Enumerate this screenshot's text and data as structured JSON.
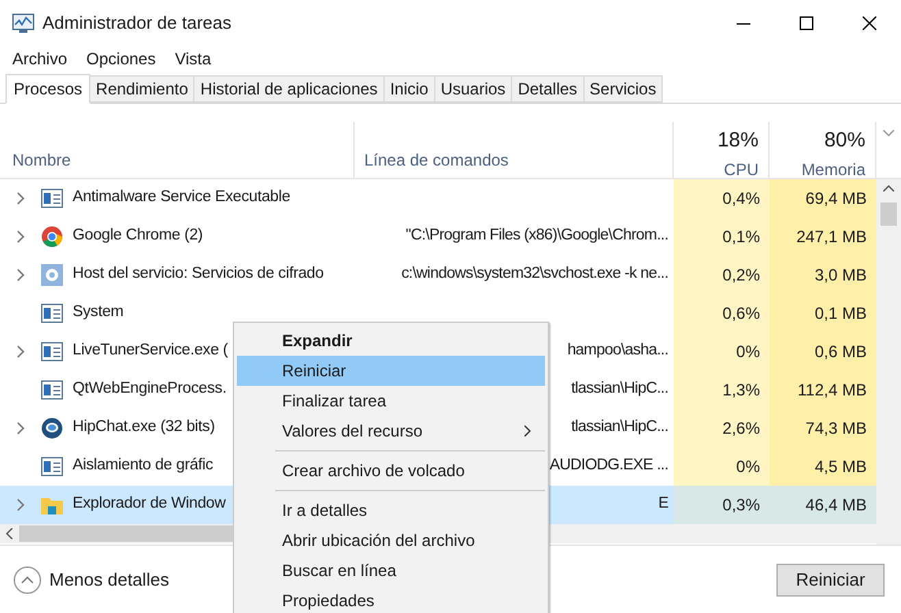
{
  "window": {
    "title": "Administrador de tareas"
  },
  "menu": [
    "Archivo",
    "Opciones",
    "Vista"
  ],
  "tabs": [
    {
      "label": "Procesos",
      "selected": true
    },
    {
      "label": "Rendimiento",
      "selected": false
    },
    {
      "label": "Historial de aplicaciones",
      "selected": false
    },
    {
      "label": "Inicio",
      "selected": false
    },
    {
      "label": "Usuarios",
      "selected": false
    },
    {
      "label": "Detalles",
      "selected": false
    },
    {
      "label": "Servicios",
      "selected": false
    }
  ],
  "columns": {
    "name": "Nombre",
    "command": "Línea de comandos",
    "cpu": {
      "label": "CPU",
      "total": "18%"
    },
    "memory": {
      "label": "Memoria",
      "total": "80%"
    }
  },
  "rows": [
    {
      "kind": "window",
      "name": "Antimalware Service Executable",
      "command": "",
      "cpu": "0,4%",
      "memory": "69,4 MB",
      "expandable": true,
      "selected": false
    },
    {
      "kind": "chrome",
      "name": "Google Chrome (2)",
      "command": "\"C:\\Program Files (x86)\\Google\\Chrom...",
      "cpu": "0,1%",
      "memory": "247,1 MB",
      "expandable": true,
      "selected": false
    },
    {
      "kind": "gear",
      "name": "Host del servicio: Servicios de cifrado",
      "command": "c:\\windows\\system32\\svchost.exe -k ne...",
      "cpu": "0,2%",
      "memory": "3,0 MB",
      "expandable": true,
      "selected": false
    },
    {
      "kind": "window",
      "name": "System",
      "command": "",
      "cpu": "0,6%",
      "memory": "0,1 MB",
      "expandable": false,
      "selected": false
    },
    {
      "kind": "window",
      "name": "LiveTunerService.exe (",
      "command": "hampoo\\asha...",
      "cpu": "0%",
      "memory": "0,6 MB",
      "expandable": true,
      "selected": false
    },
    {
      "kind": "window",
      "name": "QtWebEngineProcess.",
      "command": "tlassian\\HipC...",
      "cpu": "1,3%",
      "memory": "112,4 MB",
      "expandable": false,
      "selected": false
    },
    {
      "kind": "chat",
      "name": "HipChat.exe (32 bits)",
      "command": "tlassian\\HipC...",
      "cpu": "2,6%",
      "memory": "74,3 MB",
      "expandable": true,
      "selected": false
    },
    {
      "kind": "window",
      "name": "Aislamiento de gráfic",
      "command": "AUDIODG.EXE ...",
      "cpu": "0%",
      "memory": "4,5 MB",
      "expandable": false,
      "selected": false
    },
    {
      "kind": "folder",
      "name": "Explorador de Window",
      "command": "E",
      "cpu": "0,3%",
      "memory": "46,4 MB",
      "expandable": true,
      "selected": true
    }
  ],
  "footer": {
    "details": "Menos detalles",
    "button": "Reiniciar"
  },
  "context_menu": [
    {
      "label": "Expandir",
      "kind": "default",
      "selected": false
    },
    {
      "label": "Reiniciar",
      "kind": "item",
      "selected": true
    },
    {
      "label": "Finalizar tarea",
      "kind": "item",
      "selected": false
    },
    {
      "label": "Valores del recurso",
      "kind": "submenu",
      "selected": false
    },
    {
      "kind": "separator"
    },
    {
      "label": "Crear archivo de volcado",
      "kind": "item",
      "selected": false
    },
    {
      "kind": "separator"
    },
    {
      "label": "Ir a detalles",
      "kind": "item",
      "selected": false
    },
    {
      "label": "Abrir ubicación del archivo",
      "kind": "item",
      "selected": false
    },
    {
      "label": "Buscar en línea",
      "kind": "item",
      "selected": false
    },
    {
      "label": "Propiedades",
      "kind": "item",
      "selected": false
    }
  ]
}
